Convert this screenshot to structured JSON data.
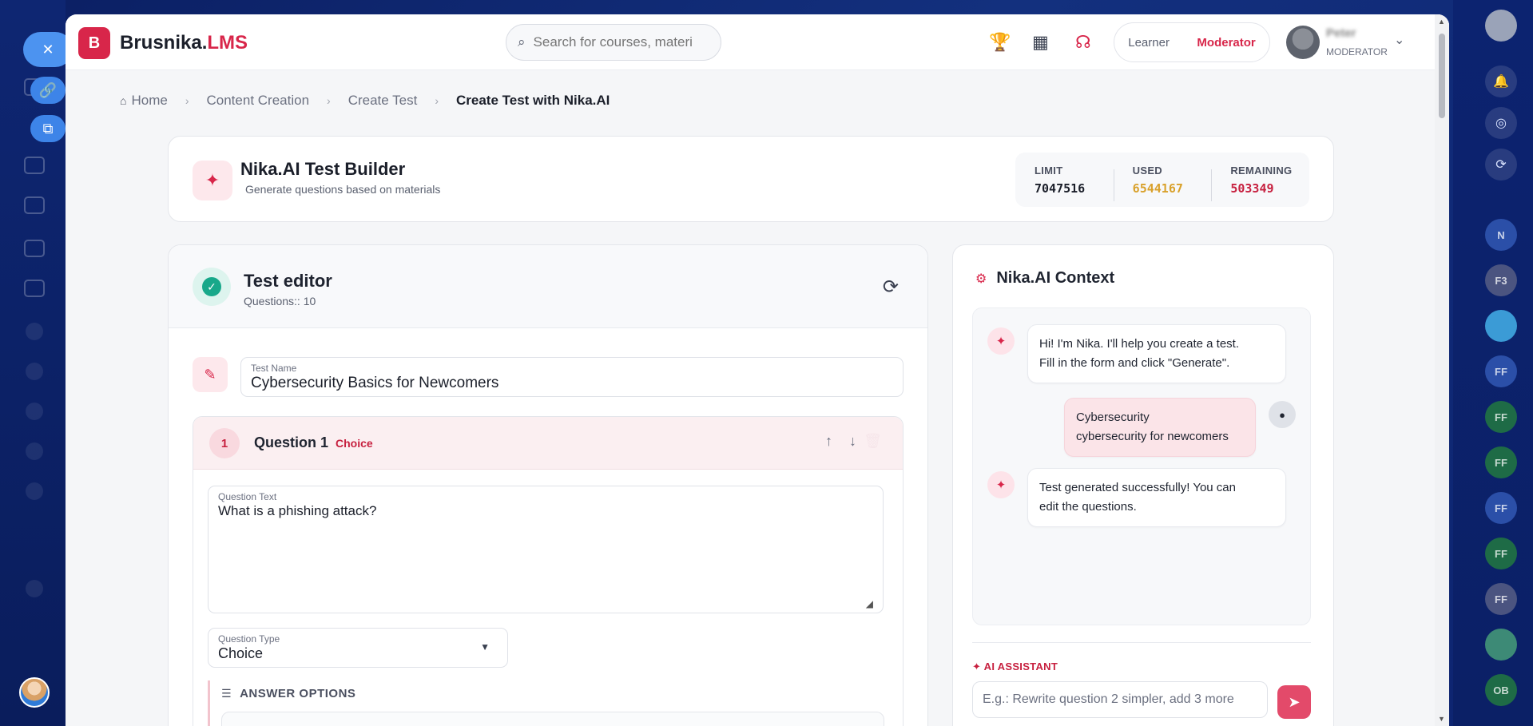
{
  "brand": {
    "name": "Brusnika.",
    "accent": "LMS",
    "logo_letter": "B",
    "color": "#d8264a"
  },
  "search": {
    "placeholder": "Search for courses, materi",
    "value": ""
  },
  "roles": {
    "learner": "Learner",
    "moderator": "Moderator"
  },
  "user": {
    "name": "Peter",
    "role": "MODERATOR"
  },
  "breadcrumb": [
    "Home",
    "Content Creation",
    "Create Test",
    "Create Test with Nika.AI"
  ],
  "builder": {
    "title": "Nika.AI Test Builder",
    "subtitle": "Generate questions based on materials",
    "stats": [
      {
        "label": "LIMIT",
        "value": "7047516",
        "color": "#1b1f2a"
      },
      {
        "label": "USED",
        "value": "6544167",
        "color": "#d9a12b"
      },
      {
        "label": "REMAINING",
        "value": "503349",
        "color": "#c7203f"
      }
    ]
  },
  "editor": {
    "title": "Test editor",
    "subtitle": "Questions:: 10",
    "test_name_label": "Test Name",
    "test_name": "Cybersecurity Basics for Newcomers",
    "question": {
      "number": "1",
      "title": "Question 1",
      "type_badge": "Choice",
      "text_label": "Question Text",
      "text": "What is a phishing attack?",
      "type_label": "Question Type",
      "type_value": "Choice",
      "answers_heading": "ANSWER OPTIONS"
    }
  },
  "context": {
    "title": "Nika.AI Context",
    "messages": [
      {
        "from": "bot",
        "lines": [
          "Hi! I'm Nika. I'll help you create a test.",
          "Fill in the form and click \"Generate\"."
        ]
      },
      {
        "from": "user",
        "lines": [
          "Cybersecurity",
          "cybersecurity for newcomers"
        ]
      },
      {
        "from": "bot",
        "lines": [
          "Test generated successfully! You can",
          "edit the questions."
        ]
      }
    ],
    "assistant_label": "AI ASSISTANT",
    "assistant_placeholder": "E.g.: Rewrite question 2 simpler, add 3 more"
  },
  "right_rail": {
    "chips": [
      "N",
      "F3",
      "",
      "FF",
      "FF",
      "FF",
      "FF",
      "FF",
      "FF",
      "",
      "OB"
    ]
  }
}
